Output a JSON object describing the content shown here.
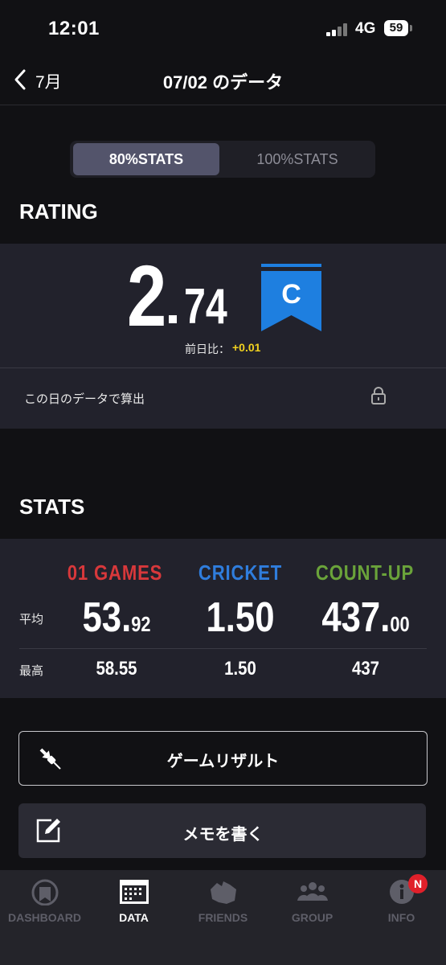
{
  "status_bar": {
    "time": "12:01",
    "network": "4G",
    "battery": "59"
  },
  "nav": {
    "back_label": "7月",
    "title": "07/02 のデータ"
  },
  "stats_toggle": {
    "options": [
      "80%STATS",
      "100%STATS"
    ],
    "selected": "80%STATS"
  },
  "rating": {
    "heading": "RATING",
    "value_int": "2",
    "value_dec": "74",
    "class_letter": "C",
    "class_color": "#1e7fe0",
    "prev_day_label": "前日比：",
    "prev_day_delta": "+0.01",
    "calc_note": "この日のデータで算出"
  },
  "stats": {
    "heading": "STATS",
    "columns": [
      {
        "name": "01 GAMES",
        "color": "#d8383b",
        "avg_int": "53.",
        "avg_dec": "92",
        "max": "58.55"
      },
      {
        "name": "CRICKET",
        "color": "#2f7ddd",
        "avg_int": "1.50",
        "avg_dec": "",
        "max": "1.50"
      },
      {
        "name": "COUNT-UP",
        "color": "#6aa33a",
        "avg_int": "437.",
        "avg_dec": "00",
        "max": "437"
      }
    ],
    "avg_label": "平均",
    "max_label": "最高"
  },
  "buttons": {
    "game_result": "ゲームリザルト",
    "write_memo": "メモを書く"
  },
  "tabs": [
    {
      "label": "DASHBOARD",
      "icon": "dashboard-icon"
    },
    {
      "label": "DATA",
      "icon": "data-icon",
      "active": true
    },
    {
      "label": "FRIENDS",
      "icon": "friends-icon"
    },
    {
      "label": "GROUP",
      "icon": "group-icon"
    },
    {
      "label": "INFO",
      "icon": "info-icon",
      "badge": "N"
    }
  ]
}
